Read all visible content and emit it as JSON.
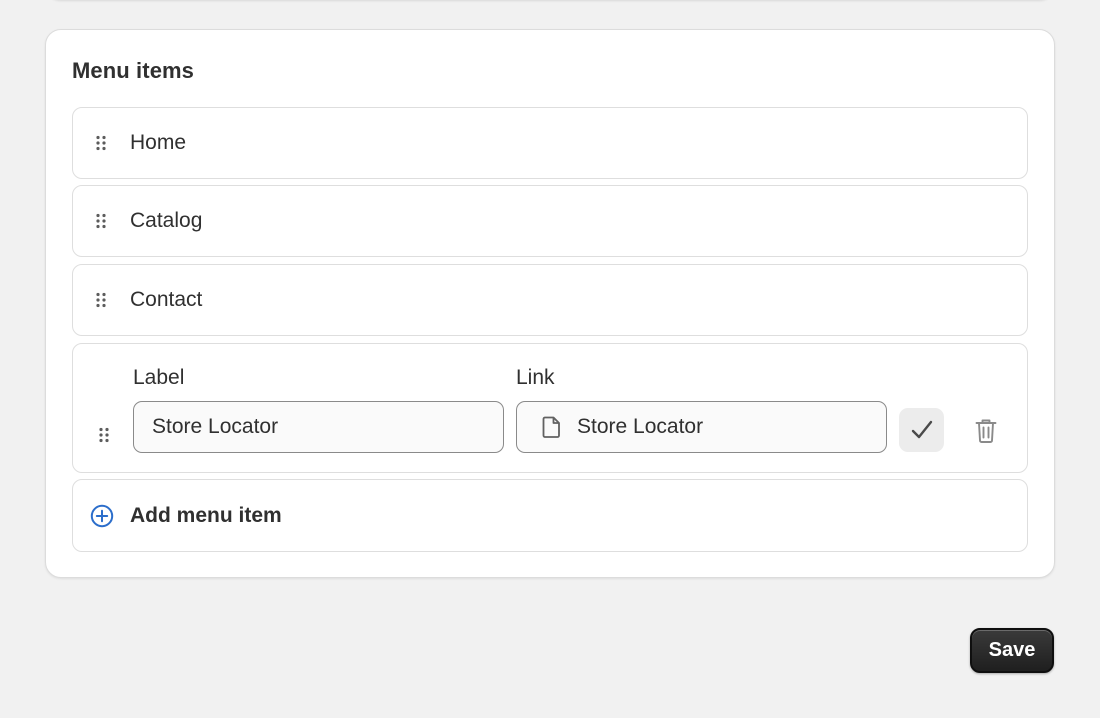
{
  "menu_card": {
    "title": "Menu items",
    "items": [
      {
        "label": "Home"
      },
      {
        "label": "Catalog"
      },
      {
        "label": "Contact"
      }
    ],
    "editing_item": {
      "label_field_label": "Label",
      "label_value": "Store Locator",
      "link_field_label": "Link",
      "link_value": "Store Locator",
      "link_icon": "page-icon",
      "confirm_icon": "checkmark-icon",
      "delete_icon": "trash-icon"
    },
    "add_item": {
      "label": "Add menu item",
      "icon": "plus-circle-icon",
      "icon_color": "#2c6ecb"
    }
  },
  "footer": {
    "save_label": "Save",
    "save_color": "#303030"
  }
}
